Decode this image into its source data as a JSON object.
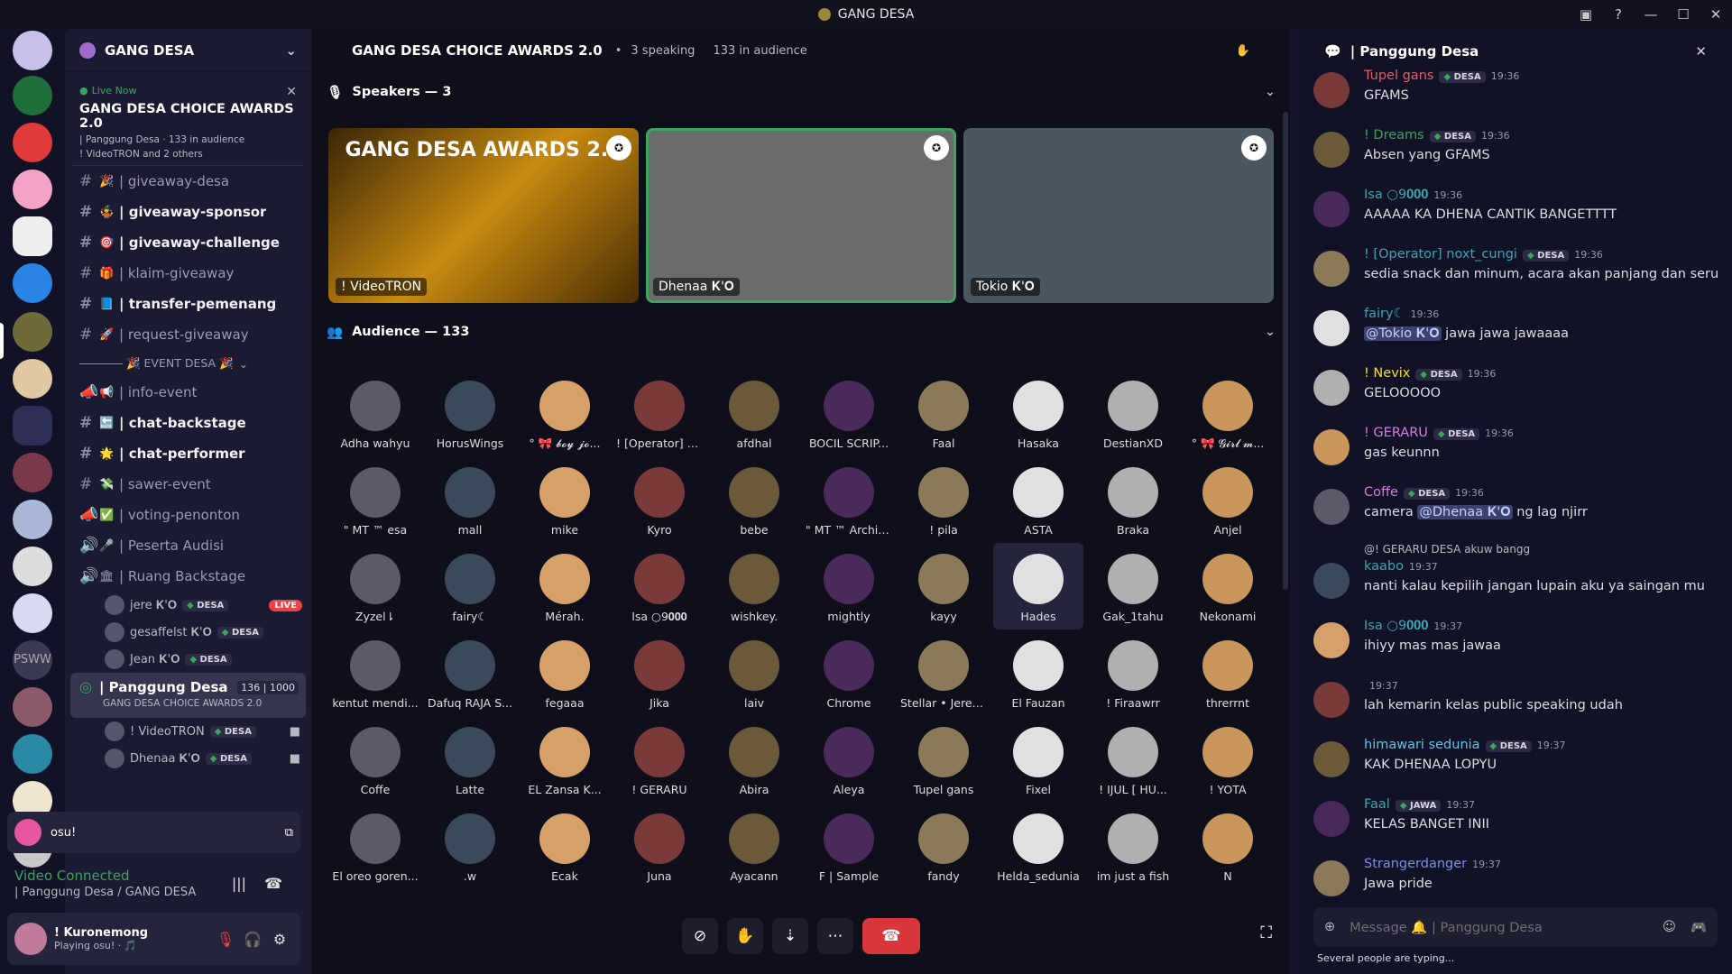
{
  "window": {
    "title": "GANG DESA"
  },
  "colors": {
    "online": "#3ba55d",
    "live": "#ed4245",
    "accent": "#5865f2"
  },
  "sidebar": {
    "server_name": "GANG DESA",
    "live_label": "Live Now",
    "event_title": "GANG DESA CHOICE AWARDS 2.0",
    "event_meta": "| Panggung Desa · 133 in audience",
    "event_sub": "! VideoTRON and 2 others",
    "channels": [
      {
        "label": "| giveaway-desa",
        "emoji": "🎉",
        "unread": false
      },
      {
        "label": "| giveaway-sponsor",
        "emoji": "🤹",
        "unread": true
      },
      {
        "label": "| giveaway-challenge",
        "emoji": "🎯",
        "unread": true
      },
      {
        "label": "| klaim-giveaway",
        "emoji": "🎁",
        "unread": false
      },
      {
        "label": "| transfer-pemenang",
        "emoji": "📘",
        "unread": true
      },
      {
        "label": "| request-giveaway",
        "emoji": "🚀",
        "unread": false
      }
    ],
    "category": "🎉 EVENT DESA 🎉",
    "channels2": [
      {
        "label": "| info-event",
        "emoji": "📢",
        "icon": "announce",
        "unread": false
      },
      {
        "label": "| chat-backstage",
        "emoji": "🔙",
        "icon": "hash",
        "unread": true
      },
      {
        "label": "| chat-performer",
        "emoji": "🌟",
        "icon": "hash",
        "unread": true
      },
      {
        "label": "| sawer-event",
        "emoji": "💸",
        "icon": "hash",
        "unread": false
      },
      {
        "label": "| voting-penonton",
        "emoji": "✅",
        "icon": "announce",
        "unread": false
      },
      {
        "label": "| Peserta Audisi",
        "emoji": "🎤",
        "icon": "voice",
        "unread": false
      },
      {
        "label": "| Ruang Backstage",
        "emoji": "🏛",
        "icon": "voice",
        "unread": false
      }
    ],
    "backstage_users": [
      {
        "name": "jere 𝐊'𝐎",
        "tag": "DESA",
        "live": "LIVE"
      },
      {
        "name": "gesaffelst 𝐊'𝐎",
        "tag": "DESA"
      },
      {
        "name": "Jean 𝐊'𝐎",
        "tag": "DESA"
      }
    ],
    "stage_channel": {
      "label": "| Panggung Desa",
      "sub": "GANG DESA CHOICE AWARDS 2.0",
      "count": "136 | 1000"
    },
    "stage_users": [
      {
        "name": "! VideoTRON",
        "tag": "DESA"
      },
      {
        "name": "Dhenaa 𝐊'𝐎",
        "tag": "DESA"
      }
    ],
    "activity": "osu!",
    "voice_status": "Video Connected",
    "voice_channel": "| Panggung Desa / GANG DESA",
    "user_name": "! Kuronemong",
    "user_status": "Playing osu! · 🎵"
  },
  "stage": {
    "title": "GANG DESA CHOICE AWARDS 2.0",
    "speaking": "3 speaking",
    "audience_count": "133 in audience",
    "speakers_header": "Speakers — 3",
    "audience_header": "Audience — 133",
    "banner": "GANG DESA AWARDS 2.0",
    "speakers": [
      {
        "name": "! VideoTRON",
        "color": "#8a5a08"
      },
      {
        "name": "Dhenaa 𝐊'𝐎",
        "color": "#6b6b6b"
      },
      {
        "name": "Tokio 𝐊'𝐎",
        "color": "#4a5660"
      }
    ],
    "audience": [
      "Adha wahyu",
      "HorusWings",
      "° 🎀 𝓫𝓸𝔂 𝓳𝓸...",
      "! [Operator] n...",
      "afdhal",
      "BOCIL SCRIP...",
      "Faal",
      "Hasaka",
      "DestianXD",
      "° 🎀 𝓖𝓲𝓻𝓵 𝓶...",
      "\" MT ™ esa",
      "mall",
      "mike",
      "Kyro",
      "bebe",
      "\" MT ™ Archiezu",
      "! pila",
      "ASTA",
      "Braka",
      "Anjel",
      "Zyzel⇂",
      "fairy☾",
      "Mérah.",
      "Isa ○9𝟎𝟎𝟎",
      "wishkey.",
      "mightly",
      "kayy",
      "Hades",
      "Gak_1tahu",
      "Nekonami",
      "kentut mendi...",
      "Dafuq RAJA S...",
      "fegaaa",
      "Jika",
      "laiv",
      "Chrome",
      "Stellar • Jeremy",
      "El Fauzan",
      "! Firaawrr",
      "threrrnt",
      "Coffe",
      "Latte",
      "EL Zansa K...",
      "! GERARU",
      "Abira",
      "Aleya",
      "Tupel gans",
      "Fixel",
      "! IJUL [ HU...",
      "! YOTA",
      "El oreo goren...",
      ".w",
      "Ecak",
      "Juna",
      "Ayacann",
      "F | Sample",
      "fandy",
      "Helda_sedunia",
      "im just a fish",
      "N"
    ],
    "highlighted": "Hades"
  },
  "chat": {
    "title": "| Panggung Desa",
    "messages": [
      {
        "author": "Tupel gans",
        "tag": "DESA",
        "time": "19:36",
        "text": "GFAMS",
        "color": "#e55b6a"
      },
      {
        "author": "! Dreams",
        "tag": "DESA",
        "time": "19:36",
        "text": "Absen yang GFAMS",
        "color": "#3ba55d"
      },
      {
        "author": "Isa ○9𝟎𝟎𝟎",
        "tag": "",
        "time": "19:36",
        "text": "AAAAA KA DHENA CANTIK BANGETTTT",
        "color": "#3ba5b0"
      },
      {
        "author": "! [Operator] noxt_cungi",
        "tag": "DESA",
        "time": "19:36",
        "text": "sedia snack dan minum, acara akan panjang dan seru",
        "color": "#3ba5b0"
      },
      {
        "author": "fairy☾",
        "tag": "",
        "time": "19:36",
        "text": "jawa jawa jawaaaa",
        "mention": "@Tokio 𝐊'𝐎",
        "color": "#3ba5b0"
      },
      {
        "author": "! Nevix",
        "tag": "DESA",
        "time": "19:36",
        "text": "GELOOOOO",
        "color": "#f0e020"
      },
      {
        "author": "! GERARU",
        "tag": "DESA",
        "time": "19:36",
        "text": "gas keunnn",
        "color": "#d77de0"
      },
      {
        "author": "Coffe",
        "tag": "DESA",
        "time": "19:36",
        "text": "ng lag njirr",
        "mention": "@Dhenaa 𝐊'𝐎",
        "prefix": "camera",
        "color": "#d77de0"
      },
      {
        "author": "kaabo",
        "tag": "",
        "time": "19:37",
        "text": "nanti kalau kepilih jangan lupain aku ya saingan mu",
        "reply": "@! GERARU  DESA  akuw bangg",
        "color": "#3ba5b0"
      },
      {
        "author": "Isa ○9𝟎𝟎𝟎",
        "tag": "",
        "time": "19:37",
        "text": "ihiyy mas mas jawaa",
        "color": "#3ba5b0"
      },
      {
        "author": "",
        "tag": "",
        "time": "19:37",
        "text": "lah kemarin kelas public speaking udah",
        "color": "#3ba5b0"
      },
      {
        "author": "himawari sedunia",
        "tag": "DESA",
        "time": "19:37",
        "text": "KAK DHENAA LOPYU",
        "color": "#5ec7e6"
      },
      {
        "author": "Faal",
        "tag": "JAWA",
        "time": "19:37",
        "text": "KELAS BANGET INII",
        "color": "#3ba5b0"
      },
      {
        "author": "Strangerdanger",
        "tag": "",
        "time": "19:37",
        "text": "Jawa pride",
        "color": "#7a8fe6"
      }
    ],
    "input_placeholder": "Message 🔔 | Panggung Desa",
    "typing": "Several people are typing..."
  }
}
